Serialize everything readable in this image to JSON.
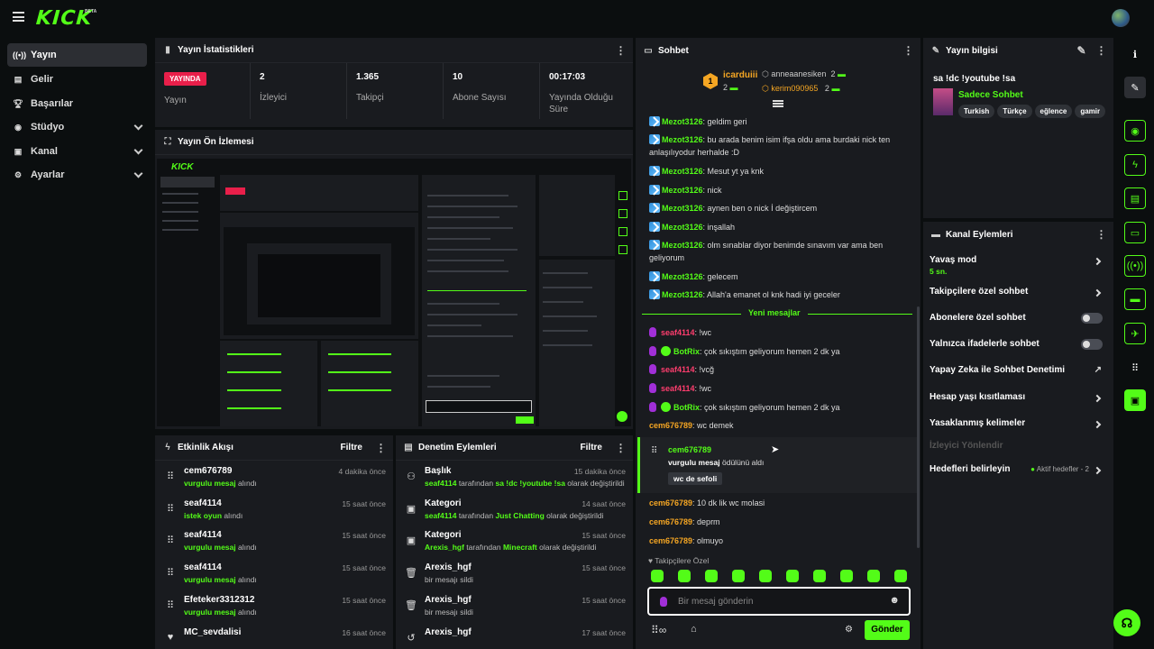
{
  "brand": {
    "logo": "KICK",
    "beta": "BETA"
  },
  "nav": [
    {
      "label": "Yayın",
      "icon": "broadcast-icon"
    },
    {
      "label": "Gelir",
      "icon": "revenue-icon"
    },
    {
      "label": "Başarılar",
      "icon": "trophy-icon"
    },
    {
      "label": "Stüdyo",
      "icon": "studio-icon"
    },
    {
      "label": "Kanal",
      "icon": "channel-icon"
    },
    {
      "label": "Ayarlar",
      "icon": "settings-icon"
    }
  ],
  "stats": {
    "title": "Yayın İstatistikleri",
    "live_badge": "YAYINDA",
    "stream_label": "Yayın",
    "viewers": {
      "value": "2",
      "label": "İzleyici"
    },
    "followers": {
      "value": "1.365",
      "label": "Takipçi"
    },
    "subs": {
      "value": "10",
      "label": "Abone Sayısı"
    },
    "uptime": {
      "value": "00:17:03",
      "label": "Yayında Olduğu Süre"
    }
  },
  "preview": {
    "title": "Yayın Ön İzlemesi"
  },
  "events": {
    "title": "Etkinlik Akışı",
    "filter": "Filtre",
    "rows": [
      {
        "name": "cem676789",
        "hl": "vurgulu mesaj",
        "rest": " alındı",
        "time": "4 dakika önce"
      },
      {
        "name": "seaf4114",
        "hl": "istek oyun",
        "rest": " alındı",
        "time": "15 saat önce"
      },
      {
        "name": "seaf4114",
        "hl": "vurgulu mesaj",
        "rest": " alındı",
        "time": "15 saat önce"
      },
      {
        "name": "seaf4114",
        "hl": "vurgulu mesaj",
        "rest": " alındı",
        "time": "15 saat önce"
      },
      {
        "name": "Efeteker3312312",
        "hl": "vurgulu mesaj",
        "rest": " alındı",
        "time": "15 saat önce"
      },
      {
        "name": "MC_sevdalisi",
        "hl": "",
        "rest": "",
        "time": "16 saat önce"
      }
    ]
  },
  "moderation": {
    "title": "Denetim Eylemleri",
    "filter": "Filtre",
    "rows": [
      {
        "name": "Başlık",
        "hl": "seaf4114",
        "mid": " tarafından ",
        "hl2": "sa !dc !youtube !sa",
        "rest": " olarak değiştirildi",
        "time": "15 dakika önce"
      },
      {
        "name": "Kategori",
        "hl": "seaf4114",
        "mid": " tarafından ",
        "hl2": "Just Chatting",
        "rest": " olarak değiştirildi",
        "time": "14 saat önce"
      },
      {
        "name": "Kategori",
        "hl": "Arexis_hgf",
        "mid": " tarafından ",
        "hl2": "Minecraft",
        "rest": " olarak değiştirildi",
        "time": "15 saat önce"
      },
      {
        "name": "Arexis_hgf",
        "hl": "",
        "mid": "bir mesajı sildi",
        "hl2": "",
        "rest": "",
        "time": "15 saat önce"
      },
      {
        "name": "Arexis_hgf",
        "hl": "",
        "mid": "bir mesajı sildi",
        "hl2": "",
        "rest": "",
        "time": "15 saat önce"
      },
      {
        "name": "Arexis_hgf",
        "hl": "",
        "mid": "",
        "hl2": "",
        "rest": "",
        "time": "17 saat önce"
      }
    ]
  },
  "chat": {
    "title": "Sohbet",
    "leaders": [
      {
        "rank": "1",
        "name": "icarduiii",
        "count": "2"
      },
      {
        "name": "anneaanesiken",
        "count": "2"
      },
      {
        "name": "kerim090965",
        "count": "2"
      }
    ],
    "messages": [
      {
        "user": "Mezot3126",
        "text": ": geldim geri"
      },
      {
        "user": "Mezot3126",
        "text": ": bu arada benim isim ifşa oldu ama burdaki nick ten anlaşılıyodur herhalde :D"
      },
      {
        "user": "Mezot3126",
        "text": ": Mesut yt ya knk"
      },
      {
        "user": "Mezot3126",
        "text": ": nick"
      },
      {
        "user": "Mezot3126",
        "text": ": aynen ben o nick İ değiştircem"
      },
      {
        "user": "Mezot3126",
        "text": ": inşallah"
      },
      {
        "user": "Mezot3126",
        "text": ": olm sınablar diyor benimde sınavım var ama ben geliyorum"
      },
      {
        "user": "Mezot3126",
        "text": ": gelecem"
      },
      {
        "user": "Mezot3126",
        "text": ": Allah'a emanet ol knk hadi iyi geceler"
      }
    ],
    "new_messages": "Yeni mesajlar",
    "new": [
      {
        "user": "seaf4114",
        "text": ": !wc",
        "kind": "pink"
      },
      {
        "user": "BotRix",
        "text": ": çok sıkıştım geliyorum hemen 2 dk ya",
        "kind": "bot"
      },
      {
        "user": "seaf4114",
        "text": ": !vcğ",
        "kind": "pink"
      },
      {
        "user": "seaf4114",
        "text": ": !wc",
        "kind": "pink"
      },
      {
        "user": "BotRix",
        "text": ": çok sıkıştım geliyorum hemen 2 dk ya",
        "kind": "bot"
      },
      {
        "user": "cem676789",
        "text": ": wc demek",
        "kind": "orange"
      }
    ],
    "highlight": {
      "user": "cem676789",
      "hl": "vurgulu mesaj",
      "rest": " ödülünü aldı",
      "msg": "wc de sefoli"
    },
    "after": [
      {
        "user": "cem676789",
        "text": ": 10 dk lik wc molasi"
      },
      {
        "user": "cem676789",
        "text": ": deprm"
      },
      {
        "user": "cem676789",
        "text": ": olmuyo"
      }
    ],
    "followers_only": "Takipçilere Özel",
    "input_placeholder": "Bir mesaj gönderin",
    "send": "Gönder"
  },
  "info": {
    "title": "Yayın bilgisi",
    "stream_title": "sa !dc !youtube !sa",
    "category": "Sadece Sohbet",
    "tags": [
      "Turkish",
      "Türkçe",
      "eğlence",
      "gamir"
    ]
  },
  "actions": {
    "title": "Kanal Eylemleri",
    "items": [
      {
        "label": "Yavaş mod",
        "sub": "5 sn."
      },
      {
        "label": "Takipçilere özel sohbet"
      },
      {
        "label": "Abonelere özel sohbet"
      },
      {
        "label": "Yalnızca ifadelerle sohbet"
      },
      {
        "label": "Yapay Zeka ile Sohbet Denetimi"
      },
      {
        "label": "Hesap yaşı kısıtlaması"
      },
      {
        "label": "Yasaklanmış kelimeler"
      },
      {
        "label": "İzleyici Yönlendir"
      },
      {
        "label": "Hedefleri belirleyin",
        "note": "Aktif hedefler - 2"
      }
    ]
  },
  "colors": {
    "accent": "#53fc18",
    "live": "#e91f4a",
    "panel": "#191b1f"
  }
}
